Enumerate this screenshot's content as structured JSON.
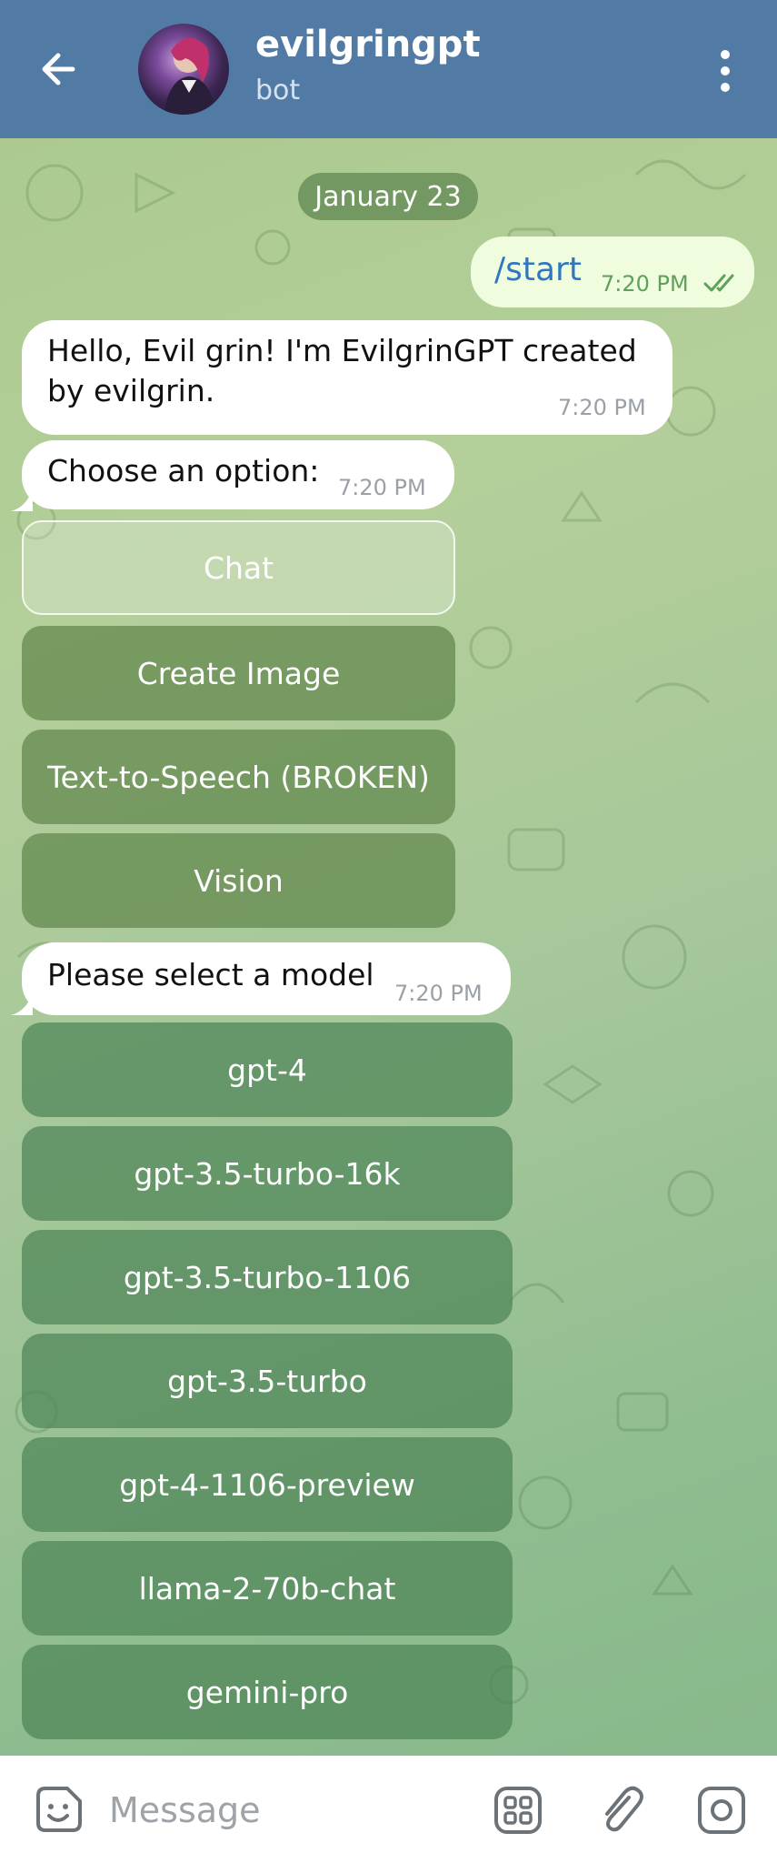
{
  "header": {
    "title": "evilgringpt",
    "subtitle": "bot",
    "back_icon": "arrow-left-icon",
    "menu_icon": "vertical-dots-icon",
    "color": "#517ba5"
  },
  "chat": {
    "date_label": "January 23",
    "messages": [
      {
        "direction": "out",
        "text": "/start",
        "time": "7:20 PM",
        "status_icon": "double-check-icon"
      },
      {
        "direction": "in",
        "text_lines": [
          "Hello, Evil grin! I'm EvilgrinGPT created",
          "by evilgrin."
        ],
        "time": "7:20 PM"
      },
      {
        "direction": "in",
        "text": "Choose an option:",
        "time": "7:20 PM"
      },
      {
        "direction": "in",
        "text": "Please select a model",
        "time": "7:20 PM"
      }
    ],
    "option_buttons": [
      "Chat",
      "Create Image",
      "Text-to-Speech (BROKEN)",
      "Vision"
    ],
    "model_buttons": [
      "gpt-4",
      "gpt-3.5-turbo-16k",
      "gpt-3.5-turbo-1106",
      "gpt-3.5-turbo",
      "gpt-4-1106-preview",
      "llama-2-70b-chat",
      "gemini-pro"
    ]
  },
  "input": {
    "placeholder": "Message",
    "emoji_icon": "sticker-emoji-icon",
    "commands_icon": "bot-commands-grid-icon",
    "attach_icon": "paperclip-icon",
    "camera_icon": "camera-icon"
  }
}
